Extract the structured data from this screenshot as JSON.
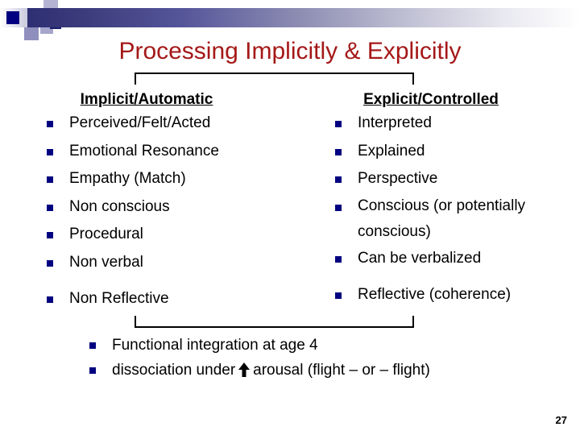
{
  "slide": {
    "title": "Processing Implicitly & Explicitly",
    "page_number": "27",
    "title_color": "#a51818",
    "bullet_color": "#000080",
    "bar_color_start": "#2e2e73",
    "bar_color_end": "#ffffff"
  },
  "columns": {
    "left": {
      "header": "Implicit/Automatic",
      "items": [
        "Perceived/Felt/Acted",
        "Emotional Resonance",
        "Empathy (Match)",
        "Non conscious",
        "Procedural",
        "Non verbal",
        "Non Reflective"
      ]
    },
    "right": {
      "header": "Explicit/Controlled",
      "items": [
        "Interpreted",
        "Explained",
        "Perspective",
        "Conscious (or potentially conscious)",
        "Can be verbalized",
        "Reflective (coherence)"
      ]
    }
  },
  "bottom": {
    "items": [
      {
        "text": "Functional integration at age 4"
      },
      {
        "text_before": "dissociation under",
        "icon": "up-arrow-icon",
        "text_after": "arousal (flight – or – flight)"
      }
    ]
  }
}
